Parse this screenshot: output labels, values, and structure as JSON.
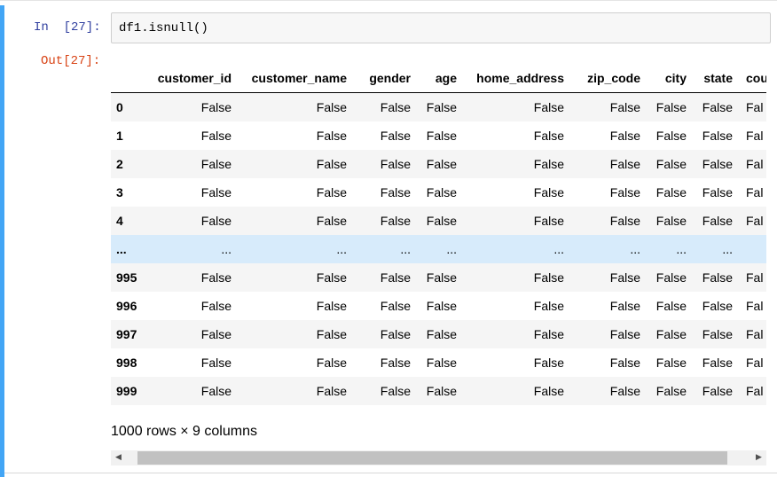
{
  "cell": {
    "in_prompt": "In  [27]:",
    "out_prompt": "Out[27]:",
    "code": "df1.isnull()"
  },
  "table": {
    "columns": [
      "customer_id",
      "customer_name",
      "gender",
      "age",
      "home_address",
      "zip_code",
      "city",
      "state",
      "count"
    ],
    "rows": [
      {
        "index": "0",
        "cells": [
          "False",
          "False",
          "False",
          "False",
          "False",
          "False",
          "False",
          "False",
          "Fal"
        ]
      },
      {
        "index": "1",
        "cells": [
          "False",
          "False",
          "False",
          "False",
          "False",
          "False",
          "False",
          "False",
          "Fal"
        ]
      },
      {
        "index": "2",
        "cells": [
          "False",
          "False",
          "False",
          "False",
          "False",
          "False",
          "False",
          "False",
          "Fal"
        ]
      },
      {
        "index": "3",
        "cells": [
          "False",
          "False",
          "False",
          "False",
          "False",
          "False",
          "False",
          "False",
          "Fal"
        ]
      },
      {
        "index": "4",
        "cells": [
          "False",
          "False",
          "False",
          "False",
          "False",
          "False",
          "False",
          "False",
          "Fal"
        ]
      },
      {
        "index": "...",
        "cells": [
          "...",
          "...",
          "...",
          "...",
          "...",
          "...",
          "...",
          "...",
          ""
        ],
        "ellipsis": true
      },
      {
        "index": "995",
        "cells": [
          "False",
          "False",
          "False",
          "False",
          "False",
          "False",
          "False",
          "False",
          "Fal"
        ]
      },
      {
        "index": "996",
        "cells": [
          "False",
          "False",
          "False",
          "False",
          "False",
          "False",
          "False",
          "False",
          "Fal"
        ]
      },
      {
        "index": "997",
        "cells": [
          "False",
          "False",
          "False",
          "False",
          "False",
          "False",
          "False",
          "False",
          "Fal"
        ]
      },
      {
        "index": "998",
        "cells": [
          "False",
          "False",
          "False",
          "False",
          "False",
          "False",
          "False",
          "False",
          "Fal"
        ]
      },
      {
        "index": "999",
        "cells": [
          "False",
          "False",
          "False",
          "False",
          "False",
          "False",
          "False",
          "False",
          "Fal"
        ]
      }
    ]
  },
  "summary": "1000 rows × 9 columns",
  "scrollbar": {
    "left_arrow": "◀",
    "right_arrow": "▶"
  }
}
